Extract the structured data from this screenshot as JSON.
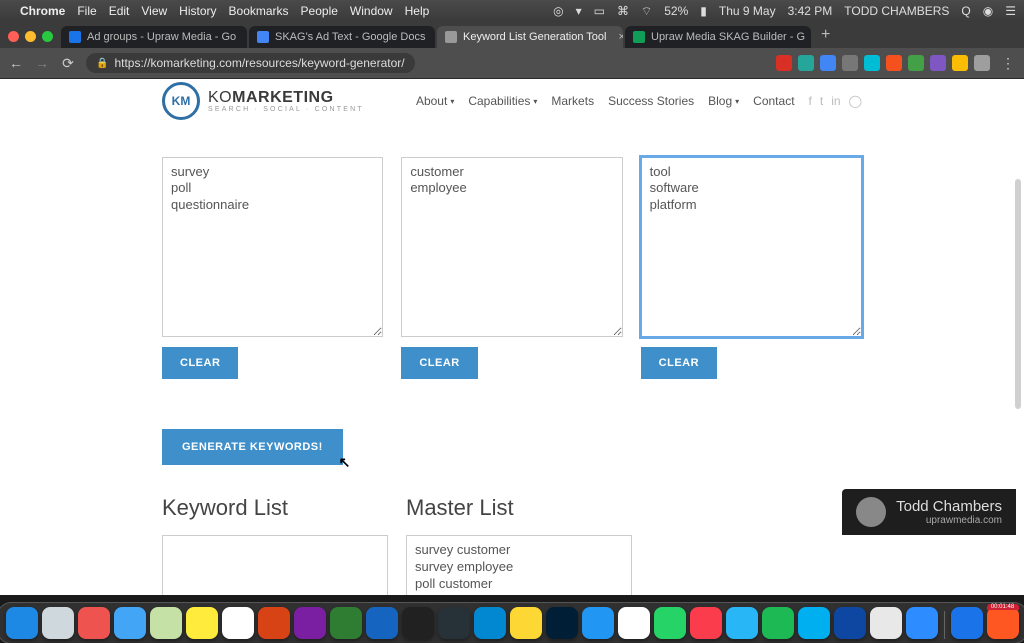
{
  "menubar": {
    "app": "Chrome",
    "items": [
      "File",
      "Edit",
      "View",
      "History",
      "Bookmarks",
      "People",
      "Window",
      "Help"
    ],
    "battery": "52%",
    "date": "Thu 9 May",
    "time": "3:42 PM",
    "user": "TODD CHAMBERS"
  },
  "tabs": [
    {
      "title": "Ad groups - Upraw Media - Go",
      "fav": "#1a73e8",
      "active": false
    },
    {
      "title": "SKAG's Ad Text - Google Docs",
      "fav": "#4285f4",
      "active": false
    },
    {
      "title": "Keyword List Generation Tool",
      "fav": "#999",
      "active": true
    },
    {
      "title": "Upraw Media SKAG Builder - G",
      "fav": "#0f9d58",
      "active": false
    }
  ],
  "address": {
    "url": "https://komarketing.com/resources/keyword-generator/"
  },
  "extensions": [
    {
      "name": "ext-red",
      "color": "#d93025"
    },
    {
      "name": "ext-teal",
      "color": "#26a69a"
    },
    {
      "name": "ext-blue",
      "color": "#4285f4"
    },
    {
      "name": "ext-gray",
      "color": "#777"
    },
    {
      "name": "ext-cyan",
      "color": "#00bcd4"
    },
    {
      "name": "ext-orange",
      "color": "#f4511e"
    },
    {
      "name": "ext-green",
      "color": "#43a047"
    },
    {
      "name": "ext-purple",
      "color": "#7e57c2"
    },
    {
      "name": "ext-yellow",
      "color": "#fbbc04"
    },
    {
      "name": "ext-avatar",
      "color": "#9e9e9e"
    }
  ],
  "site": {
    "logo_badge": "KM",
    "logo_main": "KOMARKETING",
    "logo_sub": "SEARCH · SOCIAL · CONTENT",
    "nav": [
      {
        "label": "About",
        "dd": true
      },
      {
        "label": "Capabilities",
        "dd": true
      },
      {
        "label": "Markets",
        "dd": false
      },
      {
        "label": "Success Stories",
        "dd": false
      },
      {
        "label": "Blog",
        "dd": true
      },
      {
        "label": "Contact",
        "dd": false
      }
    ]
  },
  "tool": {
    "col1": "survey\npoll\nquestionnaire",
    "col2": "customer\nemployee",
    "col3": "tool\nsoftware\nplatform",
    "clear": "CLEAR",
    "generate": "GENERATE KEYWORDS!",
    "keyword_list_title": "Keyword List",
    "master_list_title": "Master List",
    "keyword_list": "",
    "master_list": "survey customer\nsurvey employee\npoll customer\npoll employee"
  },
  "watermark": {
    "name": "Todd Chambers",
    "site": "uprawmedia.com"
  },
  "dock": {
    "timer": "00:01:48",
    "apps": [
      {
        "name": "finder",
        "color": "#1e88e5"
      },
      {
        "name": "safari",
        "color": "#cfd8dc"
      },
      {
        "name": "photos",
        "color": "#ef5350"
      },
      {
        "name": "mail",
        "color": "#42a5f5"
      },
      {
        "name": "maps",
        "color": "#c5e1a5"
      },
      {
        "name": "notes",
        "color": "#ffeb3b"
      },
      {
        "name": "reminders",
        "color": "#ffffff"
      },
      {
        "name": "powerpoint",
        "color": "#d84315"
      },
      {
        "name": "onenote",
        "color": "#7b1fa2"
      },
      {
        "name": "excel",
        "color": "#2e7d32"
      },
      {
        "name": "word",
        "color": "#1565c0"
      },
      {
        "name": "terminal",
        "color": "#212121"
      },
      {
        "name": "pycharm",
        "color": "#263238"
      },
      {
        "name": "onedrive",
        "color": "#0288d1"
      },
      {
        "name": "chrome",
        "color": "#fdd835"
      },
      {
        "name": "photoshop",
        "color": "#001e36"
      },
      {
        "name": "appstore",
        "color": "#2196f3"
      },
      {
        "name": "calendar",
        "color": "#ffffff"
      },
      {
        "name": "whatsapp",
        "color": "#25d366"
      },
      {
        "name": "music",
        "color": "#fb3c4c"
      },
      {
        "name": "telegram",
        "color": "#29b6f6"
      },
      {
        "name": "spotify",
        "color": "#1db954"
      },
      {
        "name": "skype",
        "color": "#00aff0"
      },
      {
        "name": "1password",
        "color": "#0d47a1"
      },
      {
        "name": "slack",
        "color": "#e8e8e8"
      },
      {
        "name": "zoom",
        "color": "#2d8cff"
      },
      {
        "name": "adwords",
        "color": "#1a73e8"
      },
      {
        "name": "screenrec",
        "color": "#ff5722"
      }
    ]
  }
}
